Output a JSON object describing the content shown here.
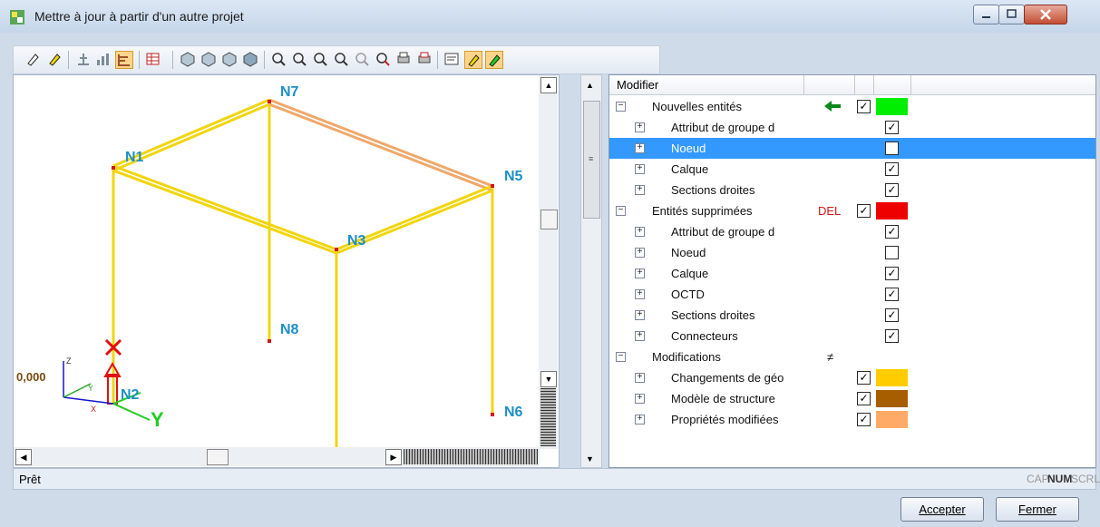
{
  "window": {
    "title": "Mettre à jour à partir d'un autre projet"
  },
  "viewport": {
    "nodes": [
      "N1",
      "N2",
      "N3",
      "N5",
      "N6",
      "N7",
      "N8"
    ],
    "coord_text": "0,000",
    "axis_labels": {
      "x": "X",
      "y": "Y",
      "z": "Z",
      "y_big": "Y"
    }
  },
  "tree": {
    "header": {
      "col1": "Modifier"
    },
    "rows": [
      {
        "level": 0,
        "label": "Nouvelles entités",
        "expand": "−",
        "mark": "arrow",
        "checked": true,
        "color": "#00ee00"
      },
      {
        "level": 1,
        "label": "Attribut de groupe d",
        "expand": "+",
        "checked": true
      },
      {
        "level": 1,
        "label": "Noeud",
        "expand": "+",
        "checked": false,
        "selected": true
      },
      {
        "level": 1,
        "label": "Calque",
        "expand": "+",
        "checked": true
      },
      {
        "level": 1,
        "label": "Sections droites",
        "expand": "+",
        "checked": true
      },
      {
        "level": 0,
        "label": "Entités supprimées",
        "expand": "−",
        "mark": "DEL",
        "checked": true,
        "color": "#ee0000"
      },
      {
        "level": 1,
        "label": "Attribut de groupe d",
        "expand": "+",
        "checked": true
      },
      {
        "level": 1,
        "label": "Noeud",
        "expand": "+",
        "checked": false
      },
      {
        "level": 1,
        "label": "Calque",
        "expand": "+",
        "checked": true
      },
      {
        "level": 1,
        "label": "OCTD",
        "expand": "+",
        "checked": true
      },
      {
        "level": 1,
        "label": "Sections droites",
        "expand": "+",
        "checked": true
      },
      {
        "level": 1,
        "label": "Connecteurs",
        "expand": "+",
        "checked": true
      },
      {
        "level": 0,
        "label": "Modifications",
        "expand": "−",
        "mark": "≠"
      },
      {
        "level": 1,
        "label": "Changements de géo",
        "expand": "+",
        "checked": true,
        "color": "#ffcc00"
      },
      {
        "level": 1,
        "label": "Modèle de structure",
        "expand": "+",
        "checked": true,
        "color": "#a65e00"
      },
      {
        "level": 1,
        "label": "Propriétés modifiées",
        "expand": "+",
        "checked": true,
        "color": "#ffaa66"
      }
    ]
  },
  "status": {
    "text": "Prêt",
    "cap": "CAP",
    "num": "NUM",
    "scrl": "SCRL"
  },
  "buttons": {
    "accept": "Accepter",
    "close": "Fermer"
  }
}
